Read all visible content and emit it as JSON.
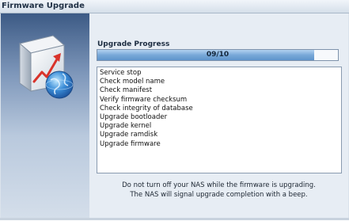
{
  "window": {
    "title": "Firmware Upgrade"
  },
  "icons": {
    "upgrade_graphic": "firmware-upgrade-box-globe-icon"
  },
  "progress": {
    "label": "Upgrade Progress",
    "text": "09/10",
    "fraction": 0.9
  },
  "log": {
    "lines": [
      "Service stop",
      "Check model name",
      "Check manifest",
      "Verify firmware checksum",
      "Check integrity of database",
      "Upgrade bootloader",
      "Upgrade kernel",
      "Upgrade ramdisk",
      "Upgrade firmware"
    ]
  },
  "notes": {
    "line1": "Do not turn off your NAS while the firmware is upgrading.",
    "line2": "The NAS will signal upgrade completion with a beep."
  },
  "colors": {
    "progress_fill": "#78a8d8",
    "sidebar_top": "#3c5a85"
  }
}
